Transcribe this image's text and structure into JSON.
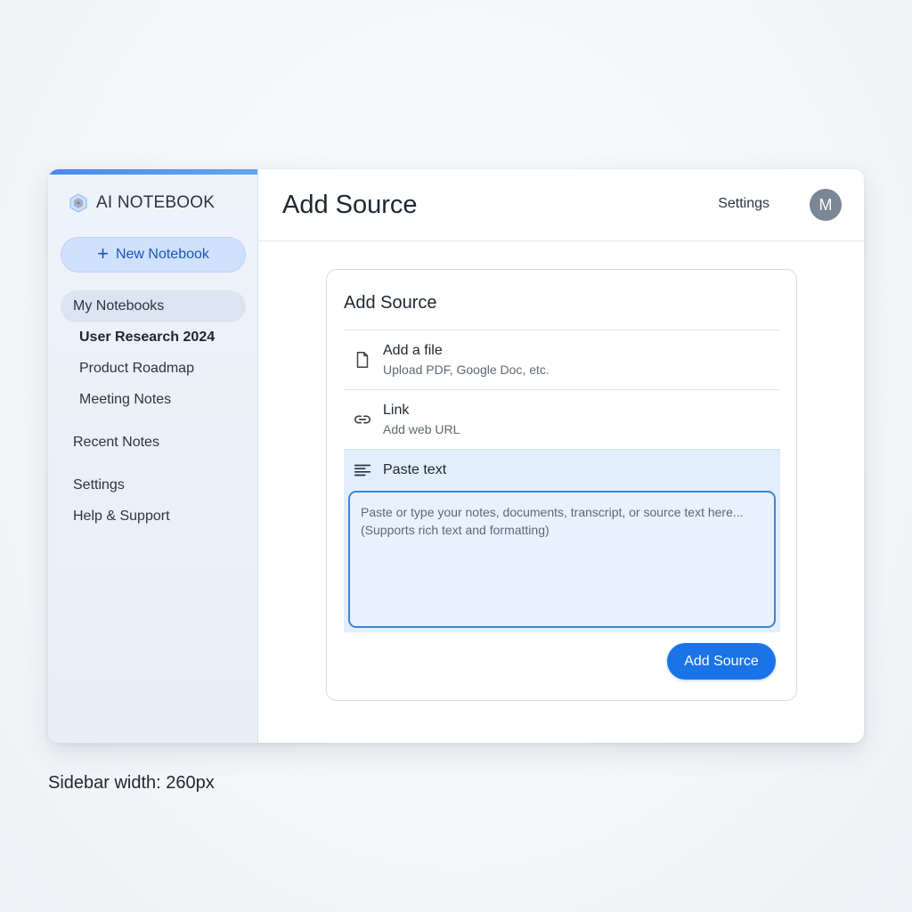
{
  "app": {
    "brand_name": "AI NOTEBOOK",
    "new_notebook_label": "New Notebook"
  },
  "sidebar": {
    "section_label": "My Notebooks",
    "notebooks": [
      {
        "label": "User Research 2024",
        "active": true
      },
      {
        "label": "Product Roadmap",
        "active": false
      },
      {
        "label": "Meeting Notes",
        "active": false
      }
    ],
    "items": [
      {
        "label": "Recent Notes"
      },
      {
        "label": "Settings"
      },
      {
        "label": "Help & Support"
      }
    ]
  },
  "header": {
    "title": "Add Source",
    "settings_label": "Settings",
    "avatar_initial": "M"
  },
  "card": {
    "title": "Add Source",
    "options": [
      {
        "icon": "file-icon",
        "title": "Add a file",
        "subtitle": "Upload PDF, Google Doc, etc."
      },
      {
        "icon": "link-icon",
        "title": "Link",
        "subtitle": "Add web URL"
      }
    ],
    "paste": {
      "icon": "text-lines-icon",
      "title": "Paste text",
      "value": "",
      "placeholder": "Paste or type your notes, documents, transcript, or source text here...\n(Supports rich text and formatting)"
    },
    "submit_label": "Add Source"
  },
  "colors": {
    "accent": "#1a73e8",
    "sidebar_bg": "#eef3fa",
    "selected_option_bg": "#e3eefc",
    "input_border": "#3c86d6",
    "avatar_bg": "#7b8794"
  },
  "caption": "Sidebar width: 260px"
}
